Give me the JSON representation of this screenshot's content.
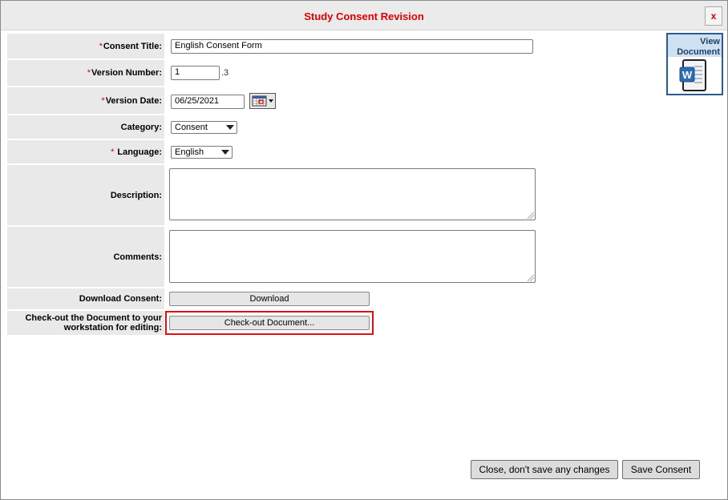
{
  "dialog": {
    "title": "Study Consent Revision",
    "close_label": "x"
  },
  "required_marker": "*",
  "view_document": {
    "line1": "View",
    "line2": "Document",
    "icon": "word-document-icon"
  },
  "form": {
    "consent_title": {
      "label": "Consent Title:",
      "value": "English Consent Form",
      "required": true
    },
    "version_number": {
      "label": "Version Number:",
      "value": "1",
      "suffix": ".3",
      "required": true
    },
    "version_date": {
      "label": "Version Date:",
      "value": "06/25/2021",
      "required": true
    },
    "category": {
      "label": "Category:",
      "selected": "Consent",
      "required": false
    },
    "language": {
      "label": "Language:",
      "selected": "English",
      "required": true
    },
    "description": {
      "label": "Description:",
      "value": ""
    },
    "comments": {
      "label": "Comments:",
      "value": ""
    },
    "download": {
      "label": "Download Consent:",
      "button": "Download"
    },
    "checkout": {
      "label_line1": "Check-out the Document to your",
      "label_line2": "workstation for editing:",
      "button": "Check-out Document..."
    }
  },
  "footer": {
    "cancel_button": "Close, don't save any changes",
    "save_button": "Save Consent"
  },
  "colors": {
    "title_red": "#e00000",
    "highlight_red": "#e01010",
    "label_bg": "#e9e9e9",
    "view_doc_border": "#2b5a8f"
  }
}
